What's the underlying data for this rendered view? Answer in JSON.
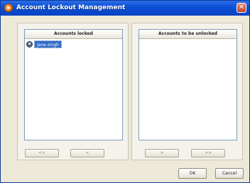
{
  "window": {
    "title": "Account Lockout Management",
    "close_glyph": "✕",
    "icon": "app-icon"
  },
  "left_panel": {
    "header": "Accounts locked",
    "items": [
      {
        "label": "jane.singh",
        "icon": "user-icon",
        "selected": true
      }
    ],
    "buttons": {
      "move_all_left": "<<",
      "move_left": "<"
    }
  },
  "right_panel": {
    "header": "Accounts to be unlocked",
    "items": [],
    "buttons": {
      "move_right": ">",
      "move_all_right": ">>"
    }
  },
  "footer": {
    "ok_label": "OK",
    "cancel_label": "Cancel"
  },
  "colors": {
    "titlebar": "#0a4fd6",
    "selection": "#316ac5",
    "dialog_bg": "#ece9d8"
  }
}
